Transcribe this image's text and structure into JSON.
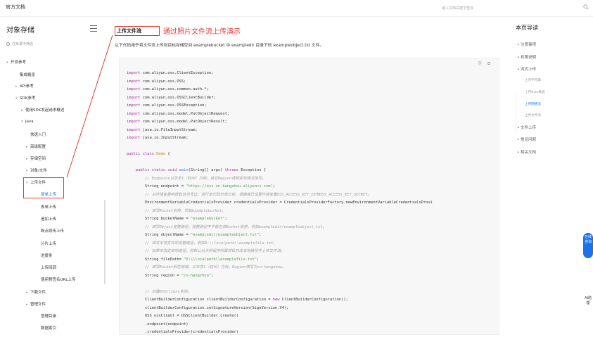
{
  "topbar": {
    "brand": "官方文档",
    "search_placeholder": "输入文档关键字查找"
  },
  "sidebar": {
    "title": "对象存储",
    "search_placeholder": "在目录中筛选",
    "items": [
      {
        "label": "开发参考",
        "caret": "▾"
      },
      {
        "label": "集成概览",
        "caret": ""
      },
      {
        "label": "API参考",
        "caret": "▸"
      },
      {
        "label": "SDK参考",
        "caret": "▾"
      },
      {
        "label": "使用SDK发起请求概述",
        "caret": "▸"
      },
      {
        "label": "Java",
        "caret": "▾"
      },
      {
        "label": "快速入门",
        "caret": ""
      },
      {
        "label": "高级配置",
        "caret": "▸"
      },
      {
        "label": "存储空间",
        "caret": "▸"
      },
      {
        "label": "对象/文件",
        "caret": "▾"
      },
      {
        "label": "上传文件",
        "caret": "▾"
      },
      {
        "label": "简单上传",
        "caret": ""
      },
      {
        "label": "表单上传",
        "caret": ""
      },
      {
        "label": "追加上传",
        "caret": ""
      },
      {
        "label": "断点续传上传",
        "caret": ""
      },
      {
        "label": "分片上传",
        "caret": ""
      },
      {
        "label": "进度条",
        "caret": ""
      },
      {
        "label": "上传回调",
        "caret": ""
      },
      {
        "label": "使用预签名URL上传",
        "caret": ""
      },
      {
        "label": "下载文件",
        "caret": "▸"
      },
      {
        "label": "管理文件",
        "caret": "▸"
      },
      {
        "label": "管理目录",
        "caret": ""
      },
      {
        "label": "数据索引",
        "caret": ""
      }
    ]
  },
  "main": {
    "heading": "上传文件流",
    "annotation": "通过照片文件流上传演示",
    "description": "以下代码用于将文件流上传到目标存储空间 examplebucket 中 exampledir 目录下的 exampleobject.txt 文件。",
    "code_tools": [
      "⎘",
      "⧉"
    ]
  },
  "code_lines": [
    [
      [
        "kw",
        "import"
      ],
      [
        "t",
        " com.aliyun.oss.ClientException;"
      ]
    ],
    [
      [
        "kw",
        "import"
      ],
      [
        "t",
        " com.aliyun.oss.OSS;"
      ]
    ],
    [
      [
        "kw",
        "import"
      ],
      [
        "t",
        " com.aliyun.oss.common.auth.*;"
      ]
    ],
    [
      [
        "kw",
        "import"
      ],
      [
        "t",
        " com.aliyun.oss.OSSClientBuilder;"
      ]
    ],
    [
      [
        "kw",
        "import"
      ],
      [
        "t",
        " com.aliyun.oss.OSSException;"
      ]
    ],
    [
      [
        "kw",
        "import"
      ],
      [
        "t",
        " com.aliyun.oss.model.PutObjectRequest;"
      ]
    ],
    [
      [
        "kw",
        "import"
      ],
      [
        "t",
        " com.aliyun.oss.model.PutObjectResult;"
      ]
    ],
    [
      [
        "kw",
        "import"
      ],
      [
        "t",
        " java.io.FileInputStream;"
      ]
    ],
    [
      [
        "kw",
        "import"
      ],
      [
        "t",
        " java.io.InputStream;"
      ]
    ],
    [
      [
        "t",
        ""
      ]
    ],
    [
      [
        "kw",
        "public class"
      ],
      [
        "t",
        " "
      ],
      [
        "cls",
        "Demo"
      ],
      [
        "t",
        " {"
      ]
    ],
    [
      [
        "t",
        ""
      ]
    ],
    [
      [
        "t",
        "    "
      ],
      [
        "kw",
        "public static void"
      ],
      [
        "t",
        " "
      ],
      [
        "fn",
        "main"
      ],
      [
        "t",
        "(String[] args) "
      ],
      [
        "kw",
        "throws"
      ],
      [
        "t",
        " Exception {"
      ]
    ],
    [
      [
        "cm",
        "        // Endpoint以华东1（杭州）为例，其它Region请按实际情况填写。"
      ]
    ],
    [
      [
        "t",
        "        String endpoint = "
      ],
      [
        "str",
        "\"https://oss-cn-hangzhou.aliyuncs.com\""
      ],
      [
        "t",
        ";"
      ]
    ],
    [
      [
        "cm",
        "        // 从环境变量中获取访问凭证。运行本代码示例之前，请确保已设置环境变量OSS_ACCESS_KEY_ID和OSS_ACCESS_KEY_SECRET。"
      ]
    ],
    [
      [
        "t",
        "        EnvironmentVariableCredentialsProvider credentialsProvider = CredentialsProviderFactory.newEnvironmentVariableCredentialsProvi"
      ]
    ],
    [
      [
        "cm",
        "        // 填写Bucket名称，例如examplebucket。"
      ]
    ],
    [
      [
        "t",
        "        String bucketName = "
      ],
      [
        "str",
        "\"examplebucket\""
      ],
      [
        "t",
        ";"
      ]
    ],
    [
      [
        "cm",
        "        // 填写Object完整路径，完整路径中不能包含Bucket名称，例如exampledir/exampleobject.txt。"
      ]
    ],
    [
      [
        "t",
        "        String objectName = "
      ],
      [
        "str",
        "\"exampledir/exampleobject.txt\""
      ],
      [
        "t",
        ";"
      ]
    ],
    [
      [
        "cm",
        "        // 填写本地文件的完整路径，例如D:\\\\localpath\\\\examplefile.txt。"
      ]
    ],
    [
      [
        "cm",
        "        // 如果未指定本地路径，则默认从示例程序所属项目对应本地路径中上传文件流。"
      ]
    ],
    [
      [
        "t",
        "        String filePath= "
      ],
      [
        "str",
        "\"D:\\\\localpath\\\\examplefile.txt\""
      ],
      [
        "t",
        ";"
      ]
    ],
    [
      [
        "cm",
        "        // 填写Bucket所在地域。以华东1（杭州）为例，Region填写为cn-hangzhou。"
      ]
    ],
    [
      [
        "t",
        "        String region = "
      ],
      [
        "str",
        "\"cn-hangzhou\""
      ],
      [
        "t",
        ";"
      ]
    ],
    [
      [
        "t",
        ""
      ]
    ],
    [
      [
        "cm",
        "        // 创建OSSClient实例。"
      ]
    ],
    [
      [
        "t",
        "        ClientBuilderConfiguration clientBuilderConfiguration = "
      ],
      [
        "kw",
        "new"
      ],
      [
        "t",
        " ClientBuilderConfiguration();"
      ]
    ],
    [
      [
        "t",
        "        clientBuilderConfiguration.setSignatureVersion(SignVersion.V4);"
      ]
    ],
    [
      [
        "t",
        "        OSS ossClient = OSSClientBuilder.create()"
      ]
    ],
    [
      [
        "t",
        "        .endpoint(endpoint)"
      ]
    ],
    [
      [
        "t",
        "        .credentialsProvider(credentialsProvider)"
      ]
    ]
  ],
  "toc": {
    "title": "本页导读",
    "items": [
      {
        "label": "注意事项",
        "sub": false,
        "active": false
      },
      {
        "label": "权限说明",
        "sub": false,
        "active": false
      },
      {
        "label": "流式上传",
        "sub": false,
        "active": false
      },
      {
        "label": "上传字符串",
        "sub": true,
        "active": false
      },
      {
        "label": "上传Byte数组",
        "sub": true,
        "active": false
      },
      {
        "label": "上传网络流",
        "sub": true,
        "active": true
      },
      {
        "label": "上传文件流",
        "sub": true,
        "active": false
      },
      {
        "label": "文件上传",
        "sub": false,
        "active": false
      },
      {
        "label": "常见问题",
        "sub": false,
        "active": false
      },
      {
        "label": "相关文档",
        "sub": false,
        "active": false
      }
    ]
  },
  "floating": {
    "online_help": "在线咨询",
    "ai_help": "AI助理"
  }
}
